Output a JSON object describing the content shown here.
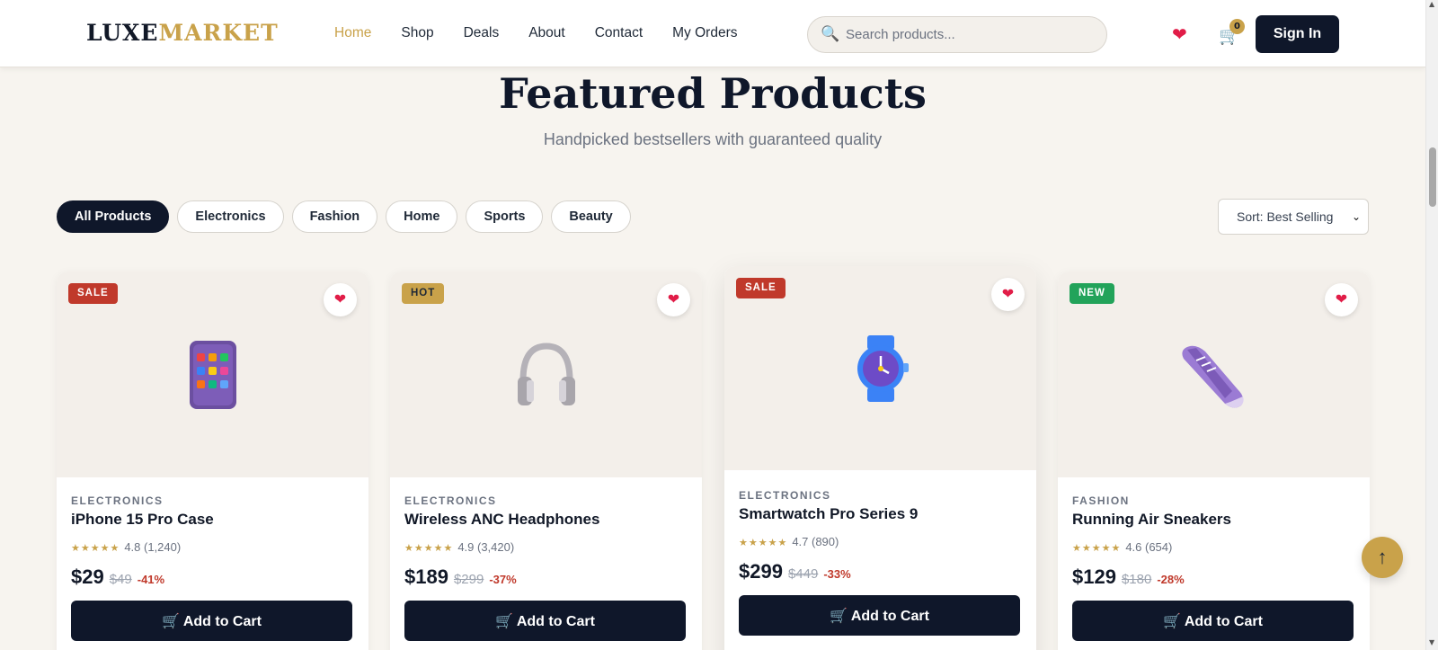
{
  "brand": {
    "part1": "LUXE",
    "part2": "MARKET"
  },
  "nav": [
    "Home",
    "Shop",
    "Deals",
    "About",
    "Contact",
    "My Orders"
  ],
  "search": {
    "placeholder": "Search products...",
    "icon": "search-icon"
  },
  "header_icons": {
    "wishlist": "heart-icon",
    "cart": "cart-icon",
    "cart_count": "0"
  },
  "signin_label": "Sign In",
  "section": {
    "title": "Featured Products",
    "subtitle": "Handpicked bestsellers with guaranteed quality"
  },
  "filters": [
    "All Products",
    "Electronics",
    "Fashion",
    "Home",
    "Sports",
    "Beauty"
  ],
  "sort": {
    "label": "Sort: Best Selling"
  },
  "products": [
    {
      "badge": "SALE",
      "category": "ELECTRONICS",
      "name": "iPhone 15 Pro Case",
      "stars": "★★★★★",
      "rating": "4.8 (1,240)",
      "price": "$29",
      "old_price": "$49",
      "discount": "-41%",
      "cart_label": "🛒 Add to Cart"
    },
    {
      "badge": "HOT",
      "category": "ELECTRONICS",
      "name": "Wireless ANC Headphones",
      "stars": "★★★★★",
      "rating": "4.9 (3,420)",
      "price": "$189",
      "old_price": "$299",
      "discount": "-37%",
      "cart_label": "🛒 Add to Cart"
    },
    {
      "badge": "SALE",
      "category": "ELECTRONICS",
      "name": "Smartwatch Pro Series 9",
      "stars": "★★★★★",
      "rating": "4.7 (890)",
      "price": "$299",
      "old_price": "$449",
      "discount": "-33%",
      "cart_label": "🛒 Add to Cart"
    },
    {
      "badge": "NEW",
      "category": "FASHION",
      "name": "Running Air Sneakers",
      "stars": "★★★★★",
      "rating": "4.6 (654)",
      "price": "$129",
      "old_price": "$180",
      "discount": "-28%",
      "cart_label": "🛒 Add to Cart"
    }
  ],
  "colors": {
    "primary": "#0f172a",
    "accent": "#c9a24a",
    "sale": "#c0392b",
    "new": "#22a35a",
    "background": "#f7f4ef"
  },
  "back_to_top": "↑"
}
